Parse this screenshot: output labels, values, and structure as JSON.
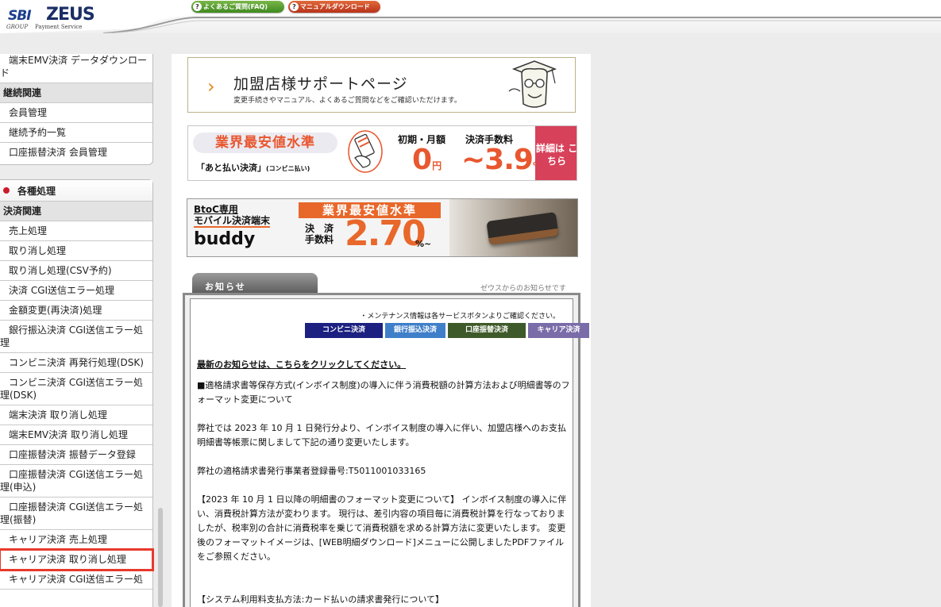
{
  "header": {
    "logo_sbi": "SBI",
    "logo_zeus": "ZEUS",
    "logo_group": "GROUP",
    "logo_payment": "Payment Service",
    "faq_button": "よくあるご質問(FAQ)",
    "manual_button": "マニュアルダウンロード",
    "faq_icon": "question-icon"
  },
  "sidebar": {
    "top_items": [
      "端末EMV決済 データダウンロード"
    ],
    "continuous_category": "継続関連",
    "continuous_items": [
      "会員管理",
      "継続予約一覧",
      "口座振替決済 会員管理"
    ],
    "section_title": "各種処理",
    "payment_category": "決済関連",
    "payment_items": [
      "売上処理",
      "取り消し処理",
      "取り消し処理(CSV予約)",
      "決済 CGI送信エラー処理",
      "金額変更(再決済)処理",
      "銀行振込決済 CGI送信エラー処理",
      "コンビニ決済 再発行処理(DSK)",
      "コンビニ決済 CGI送信エラー処理(DSK)",
      "端末決済 取り消し処理",
      "端末EMV決済 取り消し処理",
      "口座振替決済 振替データ登録",
      "口座振替決済 CGI送信エラー処理(申込)",
      "口座振替決済 CGI送信エラー処理(振替)",
      "キャリア決済 売上処理",
      "キャリア決済 取り消し処理",
      "キャリア決済 CGI送信エラー処"
    ],
    "highlight_color": "#e8392b"
  },
  "support_banner": {
    "title": "加盟店様サポートページ",
    "subtitle": "変更手続きやマニュアル、よくあるご質問などをご確認いただけます。"
  },
  "atobarai_banner": {
    "badge": "業界最安値水準",
    "label": "「あと払い決済」",
    "label_small": "(コンビニ払い)",
    "fee_head1": "初期・月額",
    "fee_head2": "決済手数料",
    "fee_val1": "0",
    "fee_unit1": "円",
    "fee_val2": "~3.9",
    "fee_unit2": "%",
    "detail": "詳細は こちら"
  },
  "buddy_banner": {
    "btoc": "BtoC専用",
    "mobile": "モバイル決済端末",
    "name": "buddy",
    "badge": "業界最安値水準",
    "kessai": "決　済 手数料",
    "rate": "2.70",
    "rate_unit": "%~"
  },
  "news": {
    "tab_label": "お知らせ",
    "from": "ゼウスからのお知らせです",
    "maintenance": "・メンテナンス情報は各サービスボタンよりご確認ください。",
    "services": [
      "コンビニ決済",
      "銀行振込決済",
      "口座振替決済",
      "キャリア決済"
    ],
    "latest_link": "最新のお知らせは、こちらをクリックしてください。",
    "p1": "■適格請求書等保存方式(インボイス制度)の導入に伴う消費税額の計算方法および明細書等のフォーマット変更について",
    "p2": "弊社では 2023 年 10 月 1 日発行分より、インボイス制度の導入に伴い、加盟店様へのお支払明細書等帳票に関しまして下記の通り変更いたします。",
    "p3": "弊社の適格請求書発行事業者登録番号:T5011001033165",
    "p4": "【2023 年 10 月 1 日以降の明細書のフォーマット変更について】 インボイス制度の導入に伴い、消費税計算方法が変わります。 現行は、差引内容の項目毎に消費税計算を行なっておりましたが、税率別の合計に消費税率を乗じて消費税額を求める計算方法に変更いたします。 変更後のフォーマットイメージは、[WEB明細ダウンロード]メニューに公開しましたPDFファイルをご参照ください。",
    "p5": "【システム利用料支払方法:カード払いの請求書発行について】"
  }
}
